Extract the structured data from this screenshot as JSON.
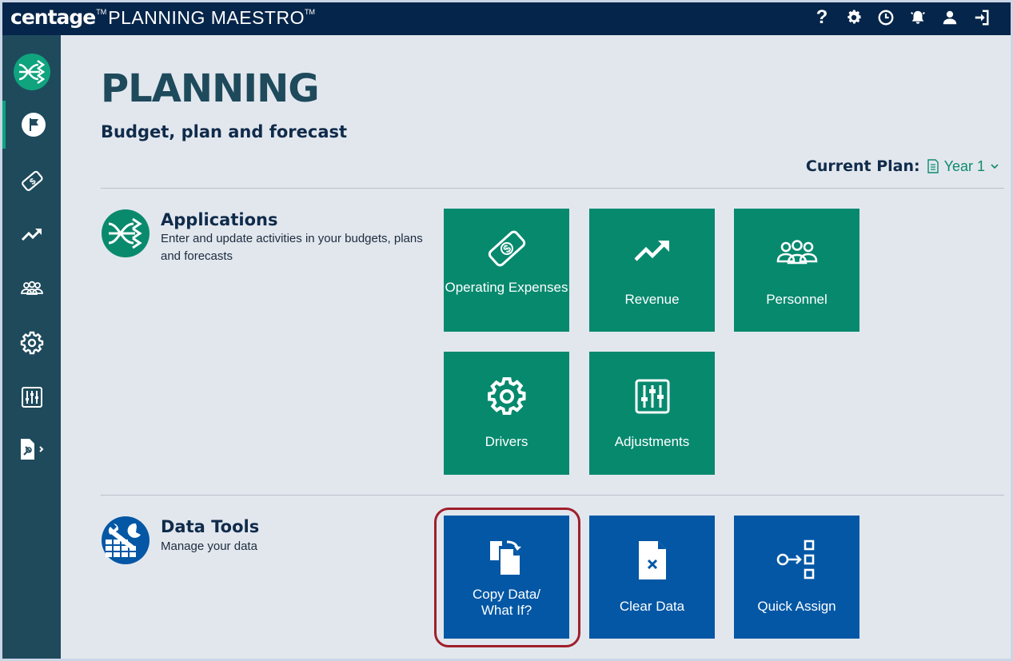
{
  "header": {
    "brand_name": "centage",
    "brand_tm": "TM",
    "product_name": "PLANNING MAESTRO",
    "product_tm": "TM",
    "icons": [
      "help-icon",
      "settings-icon",
      "history-icon",
      "notifications-icon",
      "user-icon",
      "logout-icon"
    ],
    "help_glyph": "?"
  },
  "sidebar": {
    "items": [
      {
        "name": "home",
        "icon": "crossing-arrows-logo-icon"
      },
      {
        "name": "planning",
        "icon": "flag-icon",
        "active": true
      },
      {
        "name": "expenses",
        "icon": "money-icon"
      },
      {
        "name": "revenue",
        "icon": "trend-up-icon"
      },
      {
        "name": "personnel",
        "icon": "people-icon"
      },
      {
        "name": "settings",
        "icon": "gear-icon"
      },
      {
        "name": "adjustments",
        "icon": "sliders-icon"
      },
      {
        "name": "reports",
        "icon": "document-tool-icon"
      }
    ]
  },
  "page": {
    "title": "PLANNING",
    "subtitle": "Budget, plan and forecast",
    "current_plan_label": "Current Plan:",
    "current_plan_value": "Year 1"
  },
  "applications": {
    "title": "Applications",
    "description": "Enter and update activities in your budgets, plans and forecasts",
    "tiles": [
      {
        "label": "Operating Expenses",
        "icon": "money-icon"
      },
      {
        "label": "Revenue",
        "icon": "trend-up-icon"
      },
      {
        "label": "Personnel",
        "icon": "people-icon"
      },
      {
        "label": "Drivers",
        "icon": "gear-icon"
      },
      {
        "label": "Adjustments",
        "icon": "sliders-icon"
      }
    ]
  },
  "data_tools": {
    "title": "Data Tools",
    "description": "Manage your data",
    "tiles": [
      {
        "label": "Copy Data/ What If?",
        "label_line1": "Copy Data/",
        "label_line2": "What If?",
        "icon": "copy-docs-icon",
        "highlighted": true
      },
      {
        "label": "Clear Data",
        "icon": "clear-doc-icon"
      },
      {
        "label": "Quick Assign",
        "icon": "assign-icon"
      }
    ]
  },
  "colors": {
    "topbar": "#06254a",
    "sidebar": "#1e4a5c",
    "app_tile": "#07896e",
    "tool_tile": "#0357a5",
    "highlight": "#a01f2b",
    "background": "#e2e7ee"
  }
}
